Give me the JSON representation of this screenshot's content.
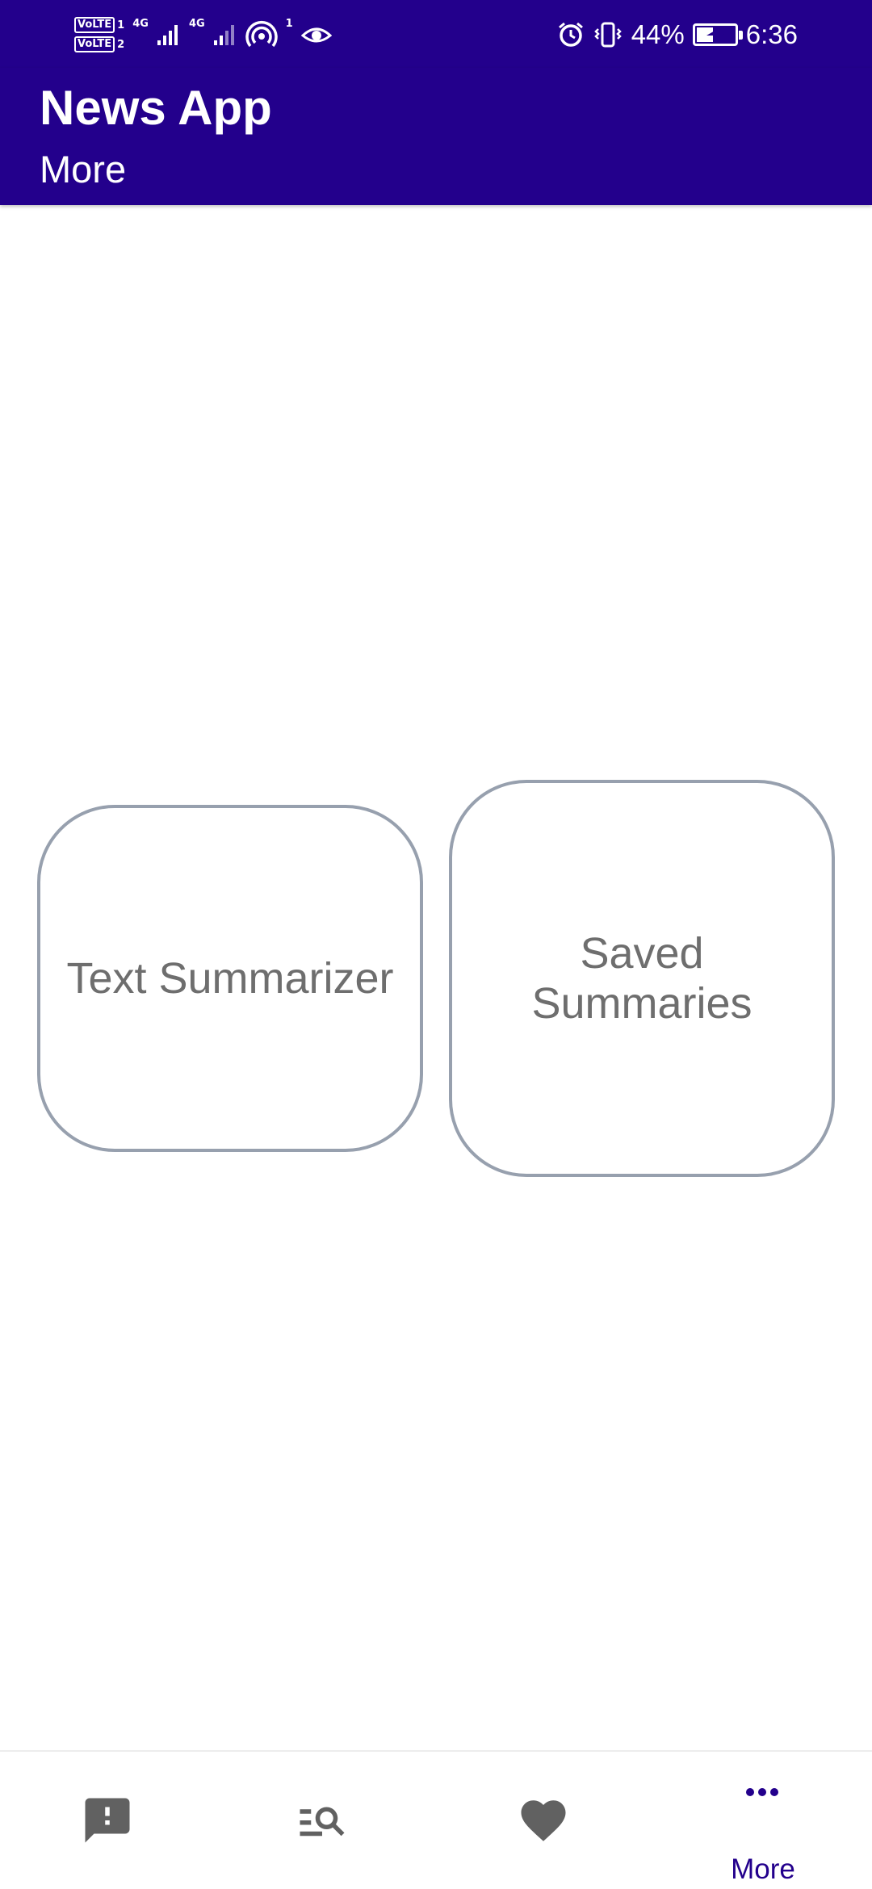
{
  "status_bar": {
    "sim1": "VoLTE",
    "sim1_num": "1",
    "sim2": "VoLTE",
    "sim2_num": "2",
    "net1": "4G",
    "net2": "4G",
    "hotspot_count": "1",
    "battery_percent": "44%",
    "battery_level": 0.44,
    "time": "6:36",
    "icons": [
      "signal-icon",
      "hotspot-icon",
      "eye-icon",
      "alarm-icon",
      "vibrate-icon",
      "battery-charging-icon"
    ]
  },
  "app_bar": {
    "title": "News App",
    "subtitle": "More"
  },
  "cards": {
    "summarizer_label": "Text Summarizer",
    "saved_label": "Saved Summaries"
  },
  "bottom_nav": {
    "items": [
      {
        "icon": "feedback-icon",
        "label": ""
      },
      {
        "icon": "manage-search-icon",
        "label": ""
      },
      {
        "icon": "favorite-icon",
        "label": ""
      },
      {
        "icon": "more-horiz-icon",
        "label": "More"
      }
    ],
    "active_color": "#23008c",
    "inactive_color": "#616161"
  },
  "colors": {
    "primary": "#23008c",
    "card_border": "#97a0ae",
    "card_text": "#6e6e6e"
  }
}
